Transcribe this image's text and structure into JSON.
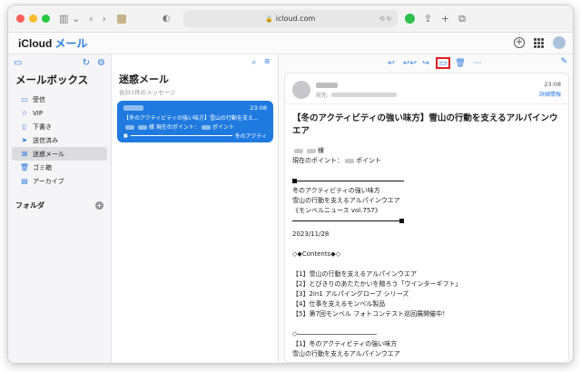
{
  "browser": {
    "url": "icloud.com"
  },
  "app": {
    "brand": "iCloud",
    "brand_app": "メール"
  },
  "sidebar": {
    "title": "メールボックス",
    "items": [
      {
        "label": "受信",
        "icon": "inbox-icon",
        "glyph": "▭"
      },
      {
        "label": "VIP",
        "icon": "star-icon",
        "glyph": "☆"
      },
      {
        "label": "下書き",
        "icon": "draft-icon",
        "glyph": "▯"
      },
      {
        "label": "送信済み",
        "icon": "sent-icon",
        "glyph": "➤"
      },
      {
        "label": "迷惑メール",
        "icon": "junk-icon",
        "glyph": "⊠"
      },
      {
        "label": "ゴミ箱",
        "icon": "trash-icon",
        "glyph": "🗑"
      },
      {
        "label": "アーカイブ",
        "icon": "archive-icon",
        "glyph": "▤"
      }
    ],
    "folders_label": "フォルダ"
  },
  "message_list": {
    "title": "迷惑メール",
    "subtitle": "合計1件のメッセージ",
    "selected": {
      "time": "23:08",
      "subject": "【冬のアクティビティの強い味方】雪山の行動を支え...",
      "preview": "様 現在のポイント：",
      "preview_tail": "ポイント",
      "preview2_tail": "冬のアクティ"
    }
  },
  "reader": {
    "to_label": "宛先:",
    "time": "23:08",
    "details_link": "詳細情報",
    "subject": "【冬のアクティビティの強い味方】雪山の行動を支えるアルパインウエア",
    "salutation_suffix": "様",
    "points_prefix": "現在のポイント：",
    "points_suffix": "ポイント",
    "lines1": [
      "冬のアクティビティの強い味方",
      "雪山の行動を支えるアルパインウエア",
      "《モンベルニュース vol.757》"
    ],
    "date": "2023/11/28",
    "contents_heading": "◇◆Contents◆◇",
    "contents": [
      "【1】雪山の行動を支えるアルパインウエア",
      "【2】とびきりのあたたかいを贈ろう「ウインターギフト」",
      "【3】2in1 アルパイングローブ シリーズ",
      "【4】仕事を支えるモンベル製品",
      "【5】第7回モンベル フォトコンテスト巡回展開催中！"
    ],
    "section_marker": "◇",
    "section1_title": "【1】冬のアクティビティの強い味方",
    "section1_sub": "雪山の行動を支えるアルパインウエア"
  },
  "colors": {
    "accent": "#2a7de1",
    "selected_card": "#1f7ae0",
    "highlight": "#e02020"
  }
}
